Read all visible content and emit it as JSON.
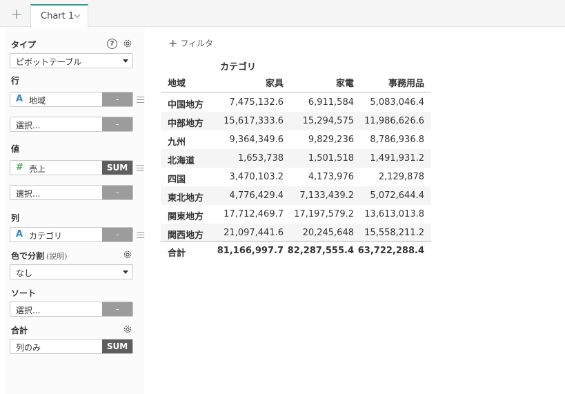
{
  "tabs": {
    "add_label": "+",
    "active_label": "Chart 1"
  },
  "panel": {
    "type_label": "タイプ",
    "type_value": "ピボットテーブル",
    "help_glyph": "?",
    "rows_label": "行",
    "rows_field": {
      "type_glyph": "A",
      "name": "地域",
      "agg": "-"
    },
    "rows_select": {
      "placeholder": "選択...",
      "agg": "-"
    },
    "values_label": "値",
    "values_field": {
      "type_glyph": "#",
      "name": "売上",
      "agg": "SUM"
    },
    "values_select": {
      "placeholder": "選択...",
      "agg": "-"
    },
    "cols_label": "列",
    "cols_field": {
      "type_glyph": "A",
      "name": "カテゴリ",
      "agg": "-"
    },
    "color_label": "色で分割",
    "color_sub": "(説明)",
    "color_value": "なし",
    "sort_label": "ソート",
    "sort_select": {
      "placeholder": "選択...",
      "agg": "-"
    },
    "total_label": "合計",
    "total_select": {
      "value": "列のみ",
      "agg": "SUM"
    }
  },
  "filter_label": "フィルタ",
  "pivot": {
    "column_group": "カテゴリ",
    "headers": [
      "地域",
      "家具",
      "家電",
      "事務用品"
    ],
    "rows": [
      [
        "中国地方",
        "7,475,132.6",
        "6,911,584",
        "5,083,046.4"
      ],
      [
        "中部地方",
        "15,617,333.6",
        "15,294,575",
        "11,986,626.6"
      ],
      [
        "九州",
        "9,364,349.6",
        "9,829,236",
        "8,786,936.8"
      ],
      [
        "北海道",
        "1,653,738",
        "1,501,518",
        "1,491,931.2"
      ],
      [
        "四国",
        "3,470,103.2",
        "4,173,976",
        "2,129,878"
      ],
      [
        "東北地方",
        "4,776,429.4",
        "7,133,439.2",
        "5,072,644.4"
      ],
      [
        "関東地方",
        "17,712,469.7",
        "17,197,579.2",
        "13,613,013.8"
      ],
      [
        "関西地方",
        "21,097,441.6",
        "20,245,648",
        "15,558,211.2"
      ]
    ],
    "total": [
      "合計",
      "81,166,997.7",
      "82,287,555.4",
      "63,722,288.4"
    ]
  }
}
